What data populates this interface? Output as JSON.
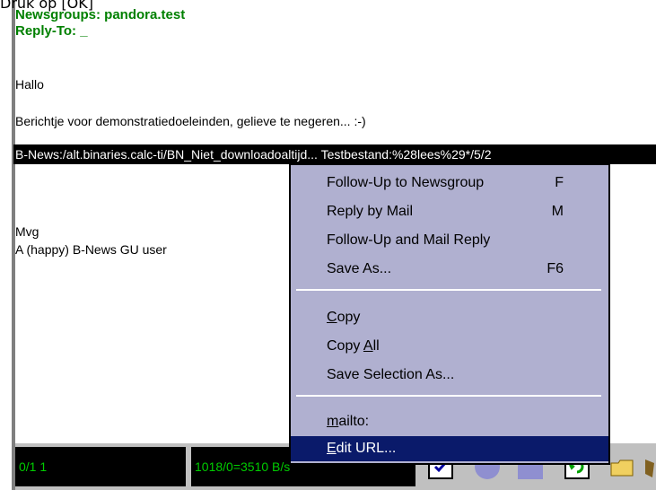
{
  "caption": "Druk op [OK]",
  "headers": {
    "newsgroups": "Newsgroups: pandora.test",
    "reply_to": "Reply-To: _"
  },
  "message": {
    "greeting": "Hallo",
    "line2": "Berichtje voor demonstratiedoeleinden, gelieve te negeren... :-)",
    "selected_url": "B-News:/alt.binaries.calc-ti/BN_Niet_downloadoaltijd... Testbestand:%28lees%29*/5/2",
    "sign1": "Mvg",
    "sign2": "A (happy) B-News GU user"
  },
  "status": {
    "left": "0/1 1",
    "mid": "1018/0=3510 B/s"
  },
  "menu": {
    "follow_up": "Follow-Up to Newsgroup",
    "follow_up_key": "F",
    "reply_mail": "Reply by Mail",
    "reply_mail_key": "M",
    "follow_mail": "Follow-Up and Mail Reply",
    "save_as": "Save As...",
    "save_as_key": "F6",
    "copy_rest": "opy",
    "copy_first": "C",
    "copy_all_pre": "Copy ",
    "copy_all_u": "A",
    "copy_all_post": "ll",
    "save_sel": "Save Selection As...",
    "mailto_u": "m",
    "mailto_rest": "ailto:",
    "edit_u": "E",
    "edit_rest": "dit URL..."
  },
  "colors": {
    "header_green": "#008000",
    "menu_bg": "#b0b0d0",
    "highlight": "#0a1a6a",
    "status_text": "#00cc00"
  }
}
